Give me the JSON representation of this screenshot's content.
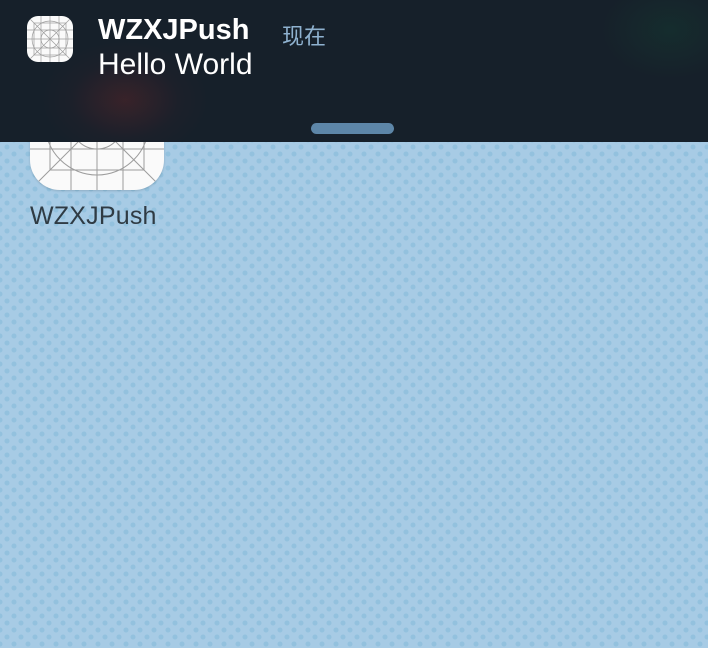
{
  "notification": {
    "app_name": "WZXJPush",
    "time": "现在",
    "message": "Hello World",
    "icon": "app-placeholder-grid-icon"
  },
  "home_screen": {
    "apps": [
      {
        "label": "WZXJPush",
        "icon": "app-placeholder-grid-icon"
      }
    ]
  },
  "colors": {
    "banner_background": "#16202a",
    "wallpaper": "#a7cbe5",
    "time_text": "#8fb2d0",
    "grabber": "#5d86a8"
  }
}
